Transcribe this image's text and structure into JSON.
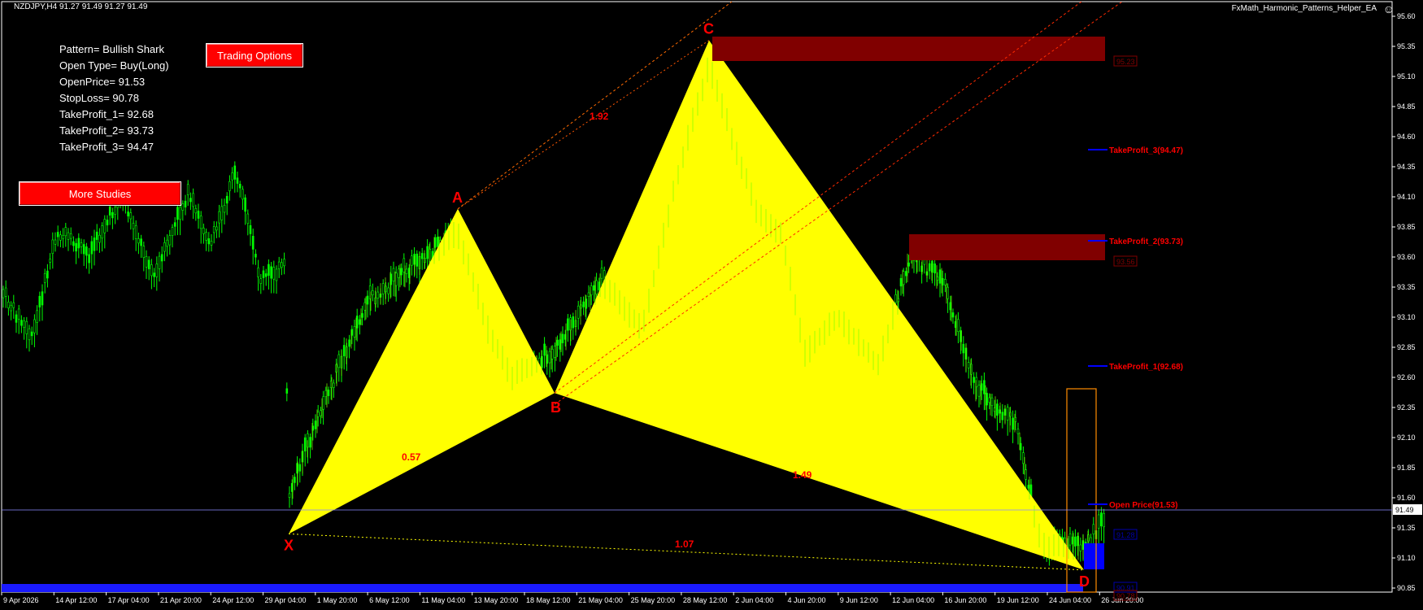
{
  "header": {
    "symbol_line": "NZDJPY,H4  91.27 91.49 91.27 91.49",
    "ea_name": "FxMath_Harmonic_Patterns_Helper_EA"
  },
  "info_panel": [
    "Pattern= Bullish Shark",
    "Open Type= Buy(Long)",
    "OpenPrice= 91.53",
    "StopLoss= 90.78",
    "TakeProfit_1= 92.68",
    "TakeProfit_2= 93.73",
    "TakeProfit_3= 94.47"
  ],
  "buttons": {
    "trading_options": "Trading Options",
    "more_studies": "More Studies"
  },
  "price_axis": {
    "ticks": [
      "95.60",
      "95.35",
      "95.10",
      "94.85",
      "94.60",
      "94.35",
      "94.10",
      "93.85",
      "93.60",
      "93.35",
      "93.10",
      "92.85",
      "92.60",
      "92.35",
      "92.10",
      "91.85",
      "91.60",
      "91.35",
      "91.10",
      "90.85"
    ],
    "current_price": "91.49"
  },
  "time_axis": {
    "ticks": [
      "9 Apr 2026",
      "14 Apr 12:00",
      "17 Apr 04:00",
      "21 Apr 20:00",
      "24 Apr 12:00",
      "29 Apr 04:00",
      "1 May 20:00",
      "6 May 12:00",
      "11 May 04:00",
      "13 May 20:00",
      "18 May 12:00",
      "21 May 04:00",
      "25 May 20:00",
      "28 May 12:00",
      "2 Jun 04:00",
      "4 Jun 20:00",
      "9 Jun 12:00",
      "12 Jun 04:00",
      "16 Jun 20:00",
      "19 Jun 12:00",
      "24 Jun 04:00",
      "26 Jun 20:00"
    ]
  },
  "pattern": {
    "points": {
      "X": {
        "label": "X",
        "price": 91.3
      },
      "A": {
        "label": "A",
        "price": 94.0
      },
      "B": {
        "label": "B",
        "price": 92.47
      },
      "C": {
        "label": "C",
        "price": 95.4
      },
      "D": {
        "label": "D",
        "price": 91.0
      }
    },
    "ratios": {
      "xb": "0.57",
      "ac": "1.92",
      "bd": "1.49",
      "xd": "1.07"
    }
  },
  "levels": {
    "tp3": "TakeProfit_3(94.47)",
    "tp2": "TakeProfit_2(93.73)",
    "tp1": "TakeProfit_1(92.68)",
    "open": "Open Price(91.53)"
  },
  "zone_labels": {
    "top_zone": "95.23",
    "mid_zone": "93.56",
    "low_box": "91.28",
    "bottom_box": "90.91",
    "bottom_red": "90.78"
  },
  "colors": {
    "background": "#000000",
    "candle": "#00ff00",
    "pattern_fill": "#ffff00",
    "label_red": "#ff0000",
    "zone_dark_red": "#800000",
    "tp_line_blue": "#0000ff",
    "orange_box": "#ff8c00",
    "bottom_band": "#1a1aff"
  }
}
